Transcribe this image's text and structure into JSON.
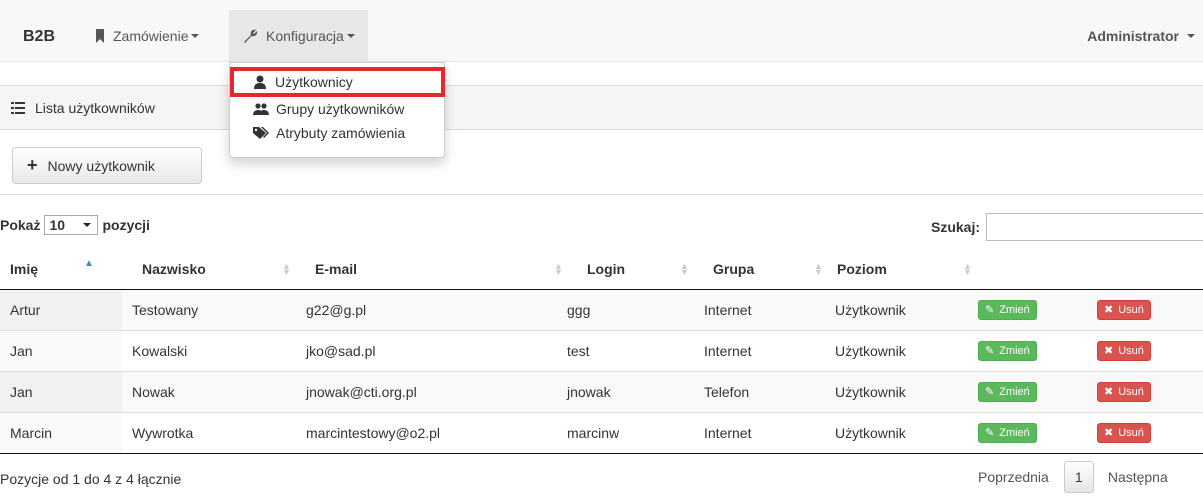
{
  "navbar": {
    "brand": "B2B",
    "zamowienie": "Zamówienie",
    "konfiguracja": "Konfiguracja",
    "admin": "Administrator"
  },
  "dropdown": {
    "items": [
      {
        "label": "Użytkownicy",
        "icon": "user-icon",
        "highlighted": true
      },
      {
        "label": "Grupy użytkowników",
        "icon": "users-icon"
      },
      {
        "label": "Atrybuty zamówienia",
        "icon": "tags-icon"
      }
    ],
    "highlight_color": "#e8262d"
  },
  "panel": {
    "title": "Lista użytkowników",
    "new_user_button": "Nowy użytkownik"
  },
  "controls": {
    "show_prefix": "Pokaż",
    "show_value": "10",
    "show_suffix": "pozycji",
    "search_label": "Szukaj:",
    "search_value": ""
  },
  "table": {
    "headers": [
      "Imię",
      "Nazwisko",
      "E-mail",
      "Login",
      "Grupa",
      "Poziom"
    ],
    "rows": [
      {
        "imie": "Artur",
        "nazwisko": "Testowany",
        "email": "g22@g.pl",
        "login": "ggg",
        "grupa": "Internet",
        "poziom": "Użytkownik"
      },
      {
        "imie": "Jan",
        "nazwisko": "Kowalski",
        "email": "jko@sad.pl",
        "login": "test",
        "grupa": "Internet",
        "poziom": "Użytkownik"
      },
      {
        "imie": "Jan",
        "nazwisko": "Nowak",
        "email": "jnowak@cti.org.pl",
        "login": "jnowak",
        "grupa": "Telefon",
        "poziom": "Użytkownik"
      },
      {
        "imie": "Marcin",
        "nazwisko": "Wywrotka",
        "email": "marcintestowy@o2.pl",
        "login": "marcinw",
        "grupa": "Internet",
        "poziom": "Użytkownik"
      }
    ],
    "edit_label": "Zmień",
    "delete_label": "Usuń"
  },
  "footer": {
    "info": "Pozycje od 1 do 4 z 4 łącznie",
    "prev": "Poprzednia",
    "page": "1",
    "next": "Następna"
  },
  "colors": {
    "edit_button": "#5cb85c",
    "delete_button": "#d9534f",
    "sort_active": "#428bca"
  }
}
